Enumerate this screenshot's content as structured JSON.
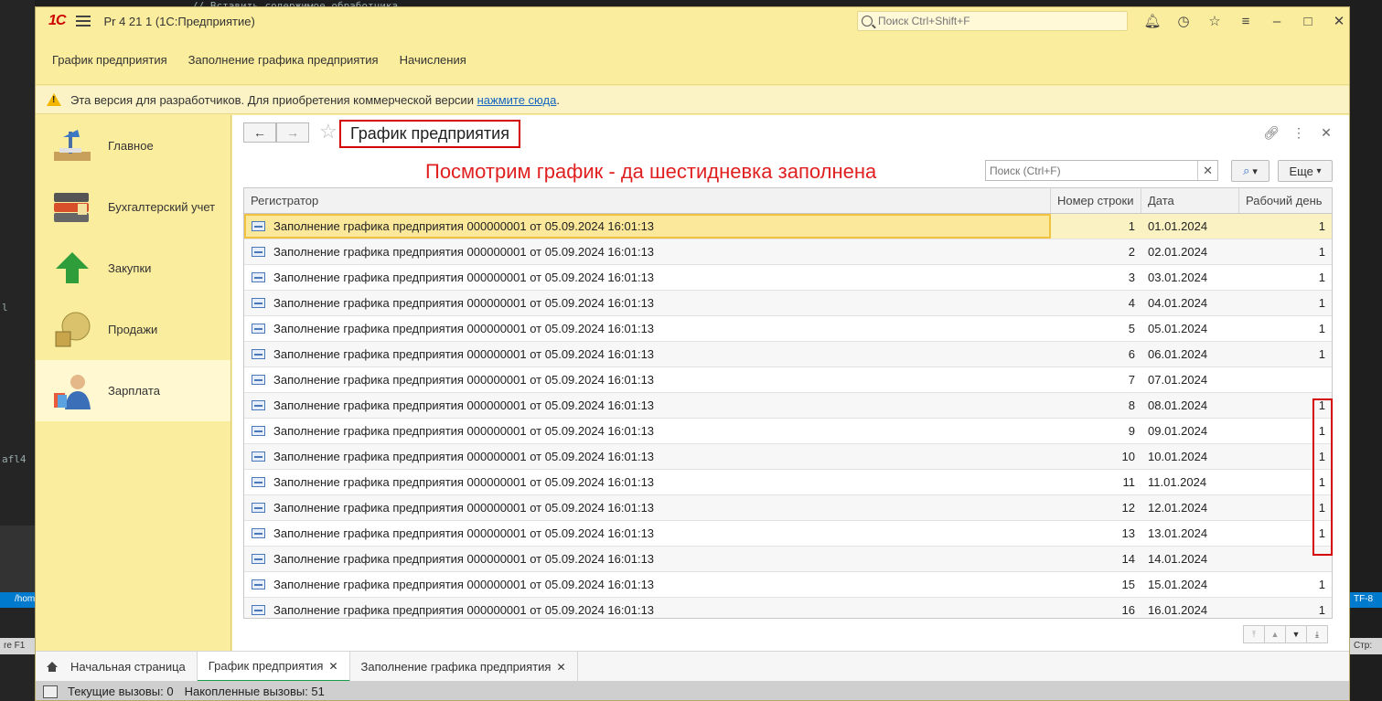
{
  "background": {
    "top_code": "// Вставить содержимое обработчика",
    "left_frag_1": "l",
    "left_frag_2": "afl4",
    "blue_path": "/hom",
    "bottom_left": "re F1",
    "right_enc": "TF-8",
    "right_frag": "Стр:"
  },
  "window": {
    "logo": "1С",
    "title": "Pr 4 21 1  (1С:Предприятие)",
    "search_placeholder": "Поиск Ctrl+Shift+F"
  },
  "sections": [
    "График предприятия",
    "Заполнение графика предприятия",
    "Начисления"
  ],
  "warning": {
    "text": "Эта версия для разработчиков. Для приобретения коммерческой версии ",
    "link": "нажмите сюда",
    "end": "."
  },
  "sidebar": [
    {
      "label": "Главное",
      "icon": "desk-lamp-icon"
    },
    {
      "label": "Бухгалтерский учет",
      "icon": "binders-icon"
    },
    {
      "label": "Закупки",
      "icon": "green-arrow-up-icon"
    },
    {
      "label": "Продажи",
      "icon": "coins-icon"
    },
    {
      "label": "Зарплата",
      "icon": "employee-icon"
    }
  ],
  "content": {
    "title": "График предприятия",
    "annotation": "Посмотрим график - да шестидневка заполнена",
    "search_placeholder": "Поиск (Ctrl+F)",
    "more": "Еще",
    "columns": [
      "Регистратор",
      "Номер строки",
      "Дата",
      "Рабочий день"
    ],
    "rows": [
      {
        "reg": "Заполнение графика предприятия 000000001 от 05.09.2024 16:01:13",
        "num": "1",
        "date": "01.01.2024",
        "work": "1"
      },
      {
        "reg": "Заполнение графика предприятия 000000001 от 05.09.2024 16:01:13",
        "num": "2",
        "date": "02.01.2024",
        "work": "1"
      },
      {
        "reg": "Заполнение графика предприятия 000000001 от 05.09.2024 16:01:13",
        "num": "3",
        "date": "03.01.2024",
        "work": "1"
      },
      {
        "reg": "Заполнение графика предприятия 000000001 от 05.09.2024 16:01:13",
        "num": "4",
        "date": "04.01.2024",
        "work": "1"
      },
      {
        "reg": "Заполнение графика предприятия 000000001 от 05.09.2024 16:01:13",
        "num": "5",
        "date": "05.01.2024",
        "work": "1"
      },
      {
        "reg": "Заполнение графика предприятия 000000001 от 05.09.2024 16:01:13",
        "num": "6",
        "date": "06.01.2024",
        "work": "1"
      },
      {
        "reg": "Заполнение графика предприятия 000000001 от 05.09.2024 16:01:13",
        "num": "7",
        "date": "07.01.2024",
        "work": ""
      },
      {
        "reg": "Заполнение графика предприятия 000000001 от 05.09.2024 16:01:13",
        "num": "8",
        "date": "08.01.2024",
        "work": "1"
      },
      {
        "reg": "Заполнение графика предприятия 000000001 от 05.09.2024 16:01:13",
        "num": "9",
        "date": "09.01.2024",
        "work": "1"
      },
      {
        "reg": "Заполнение графика предприятия 000000001 от 05.09.2024 16:01:13",
        "num": "10",
        "date": "10.01.2024",
        "work": "1"
      },
      {
        "reg": "Заполнение графика предприятия 000000001 от 05.09.2024 16:01:13",
        "num": "11",
        "date": "11.01.2024",
        "work": "1"
      },
      {
        "reg": "Заполнение графика предприятия 000000001 от 05.09.2024 16:01:13",
        "num": "12",
        "date": "12.01.2024",
        "work": "1"
      },
      {
        "reg": "Заполнение графика предприятия 000000001 от 05.09.2024 16:01:13",
        "num": "13",
        "date": "13.01.2024",
        "work": "1"
      },
      {
        "reg": "Заполнение графика предприятия 000000001 от 05.09.2024 16:01:13",
        "num": "14",
        "date": "14.01.2024",
        "work": ""
      },
      {
        "reg": "Заполнение графика предприятия 000000001 от 05.09.2024 16:01:13",
        "num": "15",
        "date": "15.01.2024",
        "work": "1"
      },
      {
        "reg": "Заполнение графика предприятия 000000001 от 05.09.2024 16:01:13",
        "num": "16",
        "date": "16.01.2024",
        "work": "1"
      }
    ]
  },
  "tabs": [
    {
      "label": "Начальная страница",
      "active": false,
      "closable": false
    },
    {
      "label": "График предприятия",
      "active": true,
      "closable": true
    },
    {
      "label": "Заполнение графика предприятия",
      "active": false,
      "closable": true
    }
  ],
  "status": {
    "current": "Текущие вызовы: 0",
    "accumulated": "Накопленные вызовы: 51"
  }
}
